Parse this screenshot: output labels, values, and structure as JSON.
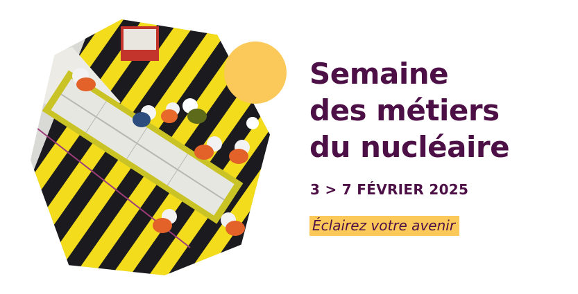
{
  "title_lines": [
    "Semaine",
    "des métiers",
    "du nucléaire"
  ],
  "dates": "3 > 7 FÉVRIER 2025",
  "tagline": "Éclairez votre avenir",
  "colors": {
    "primary": "#4d1046",
    "accent": "#fbc85a",
    "background": "#ffffff"
  },
  "photo": {
    "description_icon": "industrial-photo"
  }
}
